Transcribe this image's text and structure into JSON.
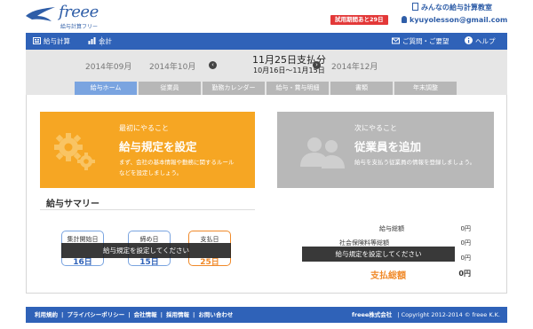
{
  "header": {
    "logo_text": "freee",
    "logo_sub": "給与計算フリー",
    "office_name": "みんなの給与計算教室",
    "trial_badge": "試用期間あと29日",
    "user_email": "kyuyolesson@gmail.com"
  },
  "nav": {
    "payroll": "給与計算",
    "accounting": "会計",
    "contact": "ご質問・ご要望",
    "help": "ヘルプ"
  },
  "months": {
    "prev2": "2014年09月",
    "prev1": "2014年10月",
    "current_title": "11月25日支払分",
    "current_range": "10月16日〜11月15日",
    "next1": "2014年12月"
  },
  "tabs": [
    "給与ホーム",
    "従業員",
    "勤務カレンダー",
    "給与・賞与明細",
    "書類",
    "年末調整"
  ],
  "cards": {
    "first": {
      "small": "最初にやること",
      "big": "給与規定を設定",
      "desc1": "まず、会社の基本情報や勤務に関するルール",
      "desc2": "などを設定しましょう。"
    },
    "next": {
      "small": "次にやること",
      "big": "従業員を追加",
      "desc1": "給与を支払う従業員の情報を登録しましょう。"
    }
  },
  "summary": {
    "title": "給与サマリー",
    "days": [
      {
        "label": "集計開始日",
        "value": "16日"
      },
      {
        "label": "締め日",
        "value": "15日"
      },
      {
        "label": "支払日",
        "value": "25日"
      }
    ],
    "toast_left": "給与規定を設定してください",
    "toast_right": "給与規定を設定してください",
    "stats": [
      {
        "label": "給与総額",
        "value": "0円"
      },
      {
        "label": "社会保険料等総額",
        "value": "0円"
      },
      {
        "label": "",
        "value": "0円"
      }
    ],
    "total_label": "支払総額",
    "total_value": "0円"
  },
  "footer": {
    "links": [
      "利用規約",
      "プライバシーポリシー",
      "会社情報",
      "採用情報",
      "お問い合わせ"
    ],
    "company": "freee株式会社",
    "copyright": "Copyright 2012-2014 © freee K.K."
  },
  "colors": {
    "brand_blue": "#2f62b8",
    "orange": "#f6a623",
    "trial_red": "#e33838"
  }
}
